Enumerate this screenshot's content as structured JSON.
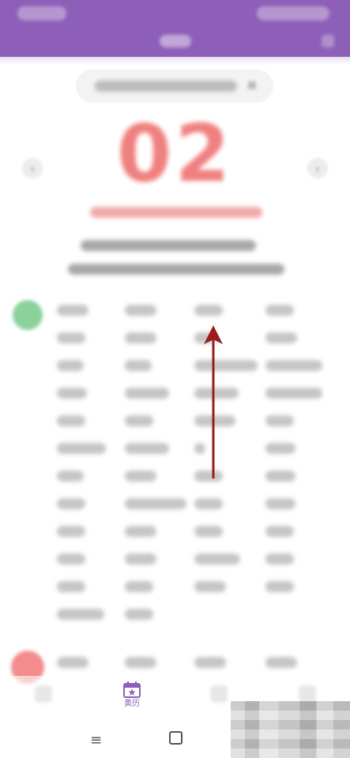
{
  "calendar": {
    "day": "02"
  },
  "bottom_nav": {
    "items": [
      {
        "label": "",
        "icon": "blurred-tab-icon"
      },
      {
        "label": "黄历",
        "icon": "calendar-star-icon",
        "active": true
      },
      {
        "label": "",
        "icon": "blurred-tab-icon"
      },
      {
        "label": "",
        "icon": "blurred-tab-icon"
      }
    ]
  },
  "system_nav": {
    "menu_symbol": "≡"
  },
  "colors": {
    "accent": "#8e5fb8",
    "day_number": "#f08080",
    "annotation_arrow": "#9b1c1c",
    "badge_good": "#8bd19b",
    "badge_bad": "#f38c8c"
  }
}
